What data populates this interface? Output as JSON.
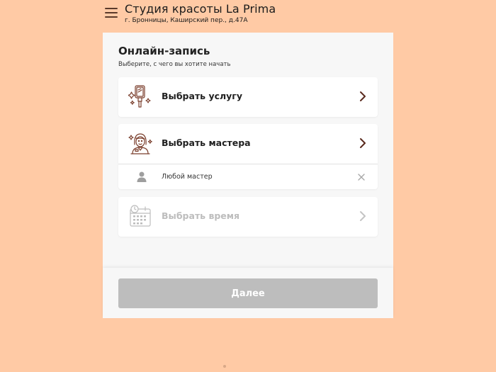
{
  "header": {
    "menu_icon": "hamburger-menu-icon",
    "studio_name": "Студия красоты La Prima",
    "address": "г. Бронницы, Каширский пер., д.47А"
  },
  "booking": {
    "title": "Онлайн-запись",
    "subtitle": "Выберите, с чего вы хотите начать",
    "options": {
      "service": {
        "label": "Выбрать услугу",
        "icon": "hand-mirror-icon",
        "enabled": true
      },
      "master": {
        "label": "Выбрать мастера",
        "icon": "master-portrait-icon",
        "enabled": true,
        "selected_value": "Любой мастер"
      },
      "time": {
        "label": "Выбрать время",
        "icon": "calendar-clock-icon",
        "enabled": false
      }
    }
  },
  "footer": {
    "next_label": "Далее"
  },
  "colors": {
    "background": "#FFCAA5",
    "panel": "#F7F7F7",
    "icon_brown": "#7A3E2C",
    "disabled": "#BDBDBD"
  }
}
